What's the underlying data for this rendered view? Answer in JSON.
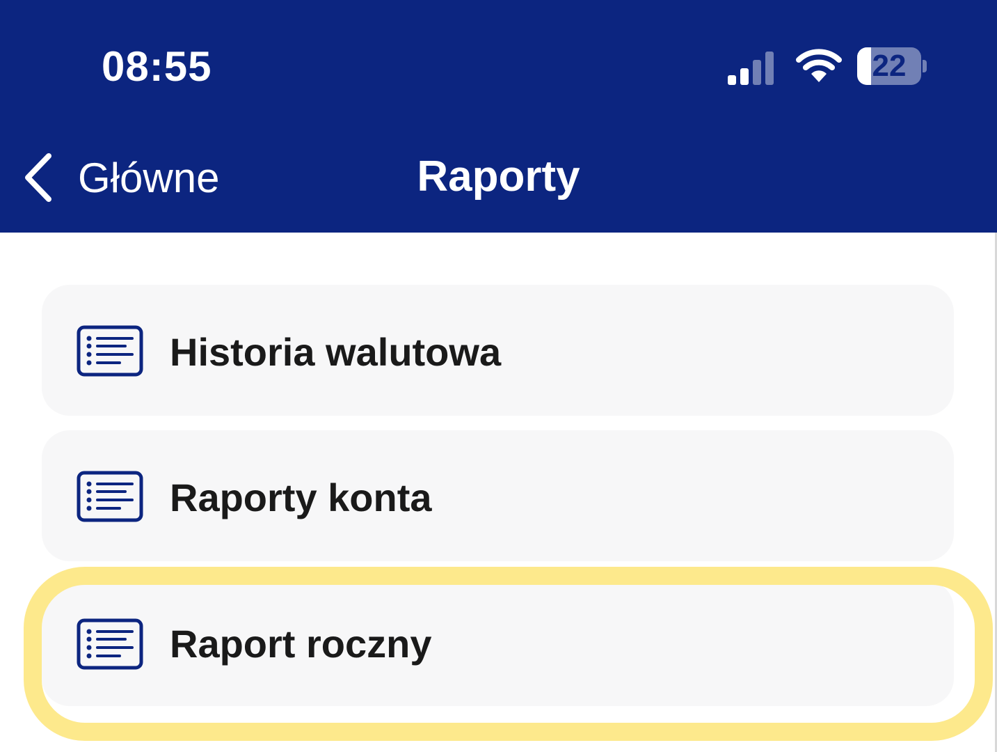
{
  "status_bar": {
    "time": "08:55",
    "battery_level": "22",
    "battery_fraction": 0.22,
    "signal_bars_active": 2,
    "signal_bars_total": 4
  },
  "nav": {
    "back_label": "Główne",
    "title": "Raporty"
  },
  "menu": {
    "items": [
      {
        "label": "Historia walutowa",
        "icon": "list-icon",
        "highlighted": false
      },
      {
        "label": "Raporty konta",
        "icon": "list-icon",
        "highlighted": false
      },
      {
        "label": "Raport roczny",
        "icon": "list-icon",
        "highlighted": true
      }
    ]
  },
  "colors": {
    "header_bg": "#0c2580",
    "icon_color": "#0c2580",
    "item_bg": "#f7f7f8",
    "highlight": "#fde98c",
    "text": "#1a1a1a"
  }
}
